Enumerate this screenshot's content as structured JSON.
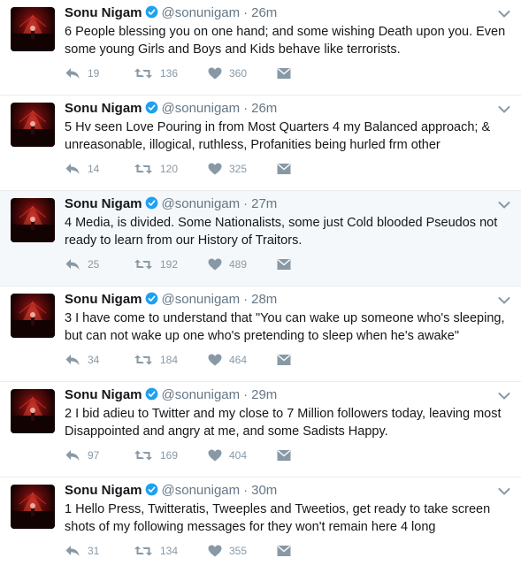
{
  "colors": {
    "text": "#14171a",
    "muted": "#657786",
    "action": "#8899a6",
    "verified": "#1da1f2",
    "highlight_bg": "#f5f8fa"
  },
  "icons": {
    "reply": "reply-icon",
    "retweet": "retweet-icon",
    "like": "heart-icon",
    "dm": "direct-message-icon",
    "verified": "verified-badge-icon",
    "menu": "chevron-down-icon"
  },
  "tweets": [
    {
      "name": "Sonu Nigam",
      "handle": "@sonunigam",
      "dot": "·",
      "time": "26m",
      "text": "6 People blessing you on one hand; and some wishing Death upon you. Even some young Girls and Boys and Kids behave like terrorists.",
      "replies": "19",
      "retweets": "136",
      "likes": "360"
    },
    {
      "name": "Sonu Nigam",
      "handle": "@sonunigam",
      "dot": "·",
      "time": "26m",
      "text": "5 Hv seen Love Pouring in from Most Quarters 4 my Balanced approach; & unreasonable, illogical, ruthless, Profanities being hurled frm other",
      "replies": "14",
      "retweets": "120",
      "likes": "325"
    },
    {
      "name": "Sonu Nigam",
      "handle": "@sonunigam",
      "dot": "·",
      "time": "27m",
      "text": "4 Media, is divided. Some Nationalists, some just Cold blooded Pseudos not ready to learn from our History of Traitors.",
      "replies": "25",
      "retweets": "192",
      "likes": "489"
    },
    {
      "name": "Sonu Nigam",
      "handle": "@sonunigam",
      "dot": "·",
      "time": "28m",
      "text": "3 I have come to understand that \"You can wake up someone who's sleeping, but can not wake up one who's pretending to sleep when he's awake\"",
      "replies": "34",
      "retweets": "184",
      "likes": "464"
    },
    {
      "name": "Sonu Nigam",
      "handle": "@sonunigam",
      "dot": "·",
      "time": "29m",
      "text": "2 I bid adieu to Twitter and my close to 7 Million followers today, leaving most Disappointed and angry at me, and some Sadists Happy.",
      "replies": "97",
      "retweets": "169",
      "likes": "404"
    },
    {
      "name": "Sonu Nigam",
      "handle": "@sonunigam",
      "dot": "·",
      "time": "30m",
      "text": "1 Hello Press, Twitteratis, Tweeples and Tweetios, get ready to take screen shots of my following messages for they won't remain here 4 long",
      "replies": "31",
      "retweets": "134",
      "likes": "355"
    }
  ]
}
